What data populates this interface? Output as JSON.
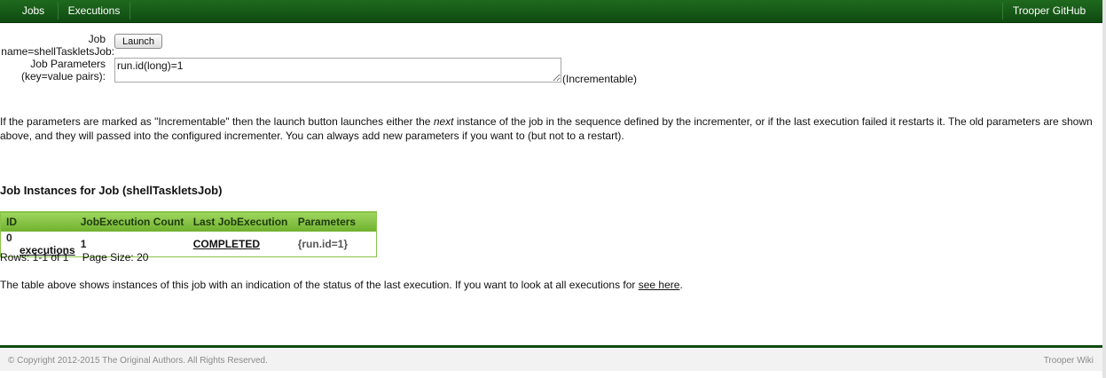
{
  "nav": {
    "left": [
      {
        "label": "Jobs"
      },
      {
        "label": "Executions"
      }
    ],
    "right": {
      "label": "Trooper GitHub"
    }
  },
  "form": {
    "job_label_line1": "Job",
    "job_label_line2": "name=shellTaskletsJob:",
    "launch_label": "Launch",
    "params_label_line1": "Job Parameters",
    "params_label_line2": "(key=value pairs):",
    "params_value": "run.id(long)=1",
    "incrementable_note": "(Incrementable)"
  },
  "info": {
    "part1": "If the parameters are marked as \"Incrementable\" then the launch button launches either the ",
    "emph": "next",
    "part2": " instance of the job in the sequence defined by the incrementer, or if the last execution failed it restarts it. The old parameters are shown above, and they will passed into the configured incrementer. You can always add new parameters if you want to (but not to a restart)."
  },
  "instances": {
    "title": "Job Instances for Job (shellTaskletsJob)",
    "columns": [
      "ID",
      "JobExecution Count",
      "Last JobExecution",
      "Parameters"
    ],
    "rows": [
      {
        "id": "0",
        "link": "executions",
        "count": "1",
        "status": "COMPLETED",
        "params": "{run.id=1}"
      }
    ],
    "rows_text": "Rows: 1-1 of 1",
    "page_size_text": "Page Size: 20",
    "note_prefix": "The table above shows instances of this job with an indication of the status of the last execution. If you want to look at all executions for ",
    "note_link": "see here",
    "note_suffix": "."
  },
  "footer": {
    "copyright": "© Copyright 2012-2015 The Original Authors. All Rights Reserved.",
    "wiki": "Trooper Wiki"
  },
  "colors": {
    "nav_green": "#0f4a10",
    "table_header_green": "#8bc34a"
  }
}
